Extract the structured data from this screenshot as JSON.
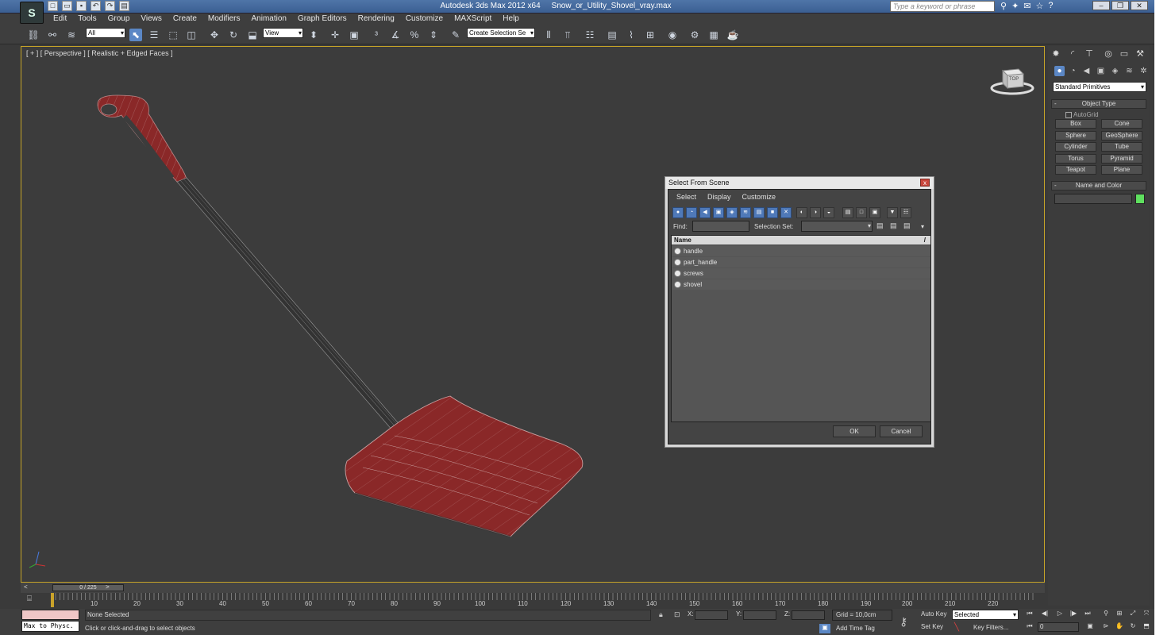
{
  "app": {
    "title": "Autodesk 3ds Max  2012 x64",
    "file": "Snow_or_Utility_Shovel_vray.max",
    "logo": "3ds-max-logo",
    "search_placeholder": "Type a keyword or phrase"
  },
  "menu": [
    "Edit",
    "Tools",
    "Group",
    "Views",
    "Create",
    "Modifiers",
    "Animation",
    "Graph Editors",
    "Rendering",
    "Customize",
    "MAXScript",
    "Help"
  ],
  "toolbar": {
    "selection_filter": "All",
    "reference_coord": "View",
    "named_selection_set": "Create Selection Se"
  },
  "viewport": {
    "label": "[ + ] [ Perspective ] [ Realistic + Edged Faces ]",
    "viewcube_label": "TOP"
  },
  "command_panel": {
    "category": "Standard Primitives",
    "object_type_title": "Object Type",
    "autogrid": "AutoGrid",
    "buttons": [
      "Box",
      "Cone",
      "Sphere",
      "GeoSphere",
      "Cylinder",
      "Tube",
      "Torus",
      "Pyramid",
      "Teapot",
      "Plane"
    ],
    "name_color_title": "Name and Color",
    "rollout_collapse": "-",
    "object_color": "#5fe05f"
  },
  "dialog": {
    "title": "Select From Scene",
    "close": "x",
    "menu": [
      "Select",
      "Display",
      "Customize"
    ],
    "find_label": "Find:",
    "selection_set_label": "Selection Set:",
    "column_name": "Name",
    "sort_indicator": "/",
    "objects": [
      "handle",
      "part_handle",
      "screws",
      "shovel"
    ],
    "ok": "OK",
    "cancel": "Cancel"
  },
  "timeline": {
    "frame_slider": "0 / 225",
    "prev": "<",
    "next": ">",
    "ticks": [
      "10",
      "20",
      "30",
      "40",
      "50",
      "60",
      "70",
      "80",
      "90",
      "100",
      "110",
      "120",
      "130",
      "140",
      "150",
      "160",
      "170",
      "180",
      "190",
      "200",
      "210",
      "220"
    ]
  },
  "status": {
    "maxscript_listener": "Max to Physc.",
    "selection": "None Selected",
    "prompt": "Click or click-and-drag to select objects",
    "x_label": "X:",
    "y_label": "Y:",
    "z_label": "Z:",
    "grid": "Grid = 10,0cm",
    "add_time_tag": "Add Time Tag",
    "auto_key": "Auto Key",
    "set_key": "Set Key",
    "key_mode": "Selected",
    "key_filters": "Key Filters...",
    "current_frame": "0"
  },
  "colors": {
    "mesh": "#8a2828",
    "viewport_border": "#c6a428",
    "active_tool": "#5b87c5"
  }
}
